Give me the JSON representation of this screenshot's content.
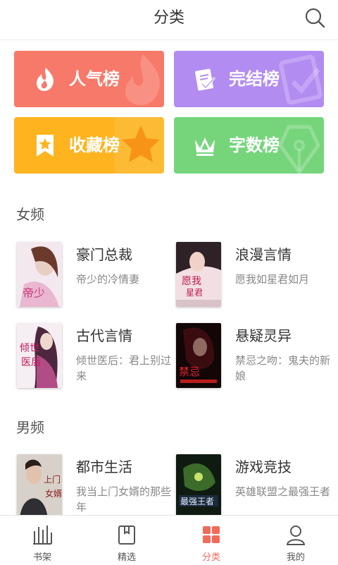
{
  "header": {
    "title": "分类",
    "search_icon": "search-icon"
  },
  "rankings": [
    {
      "label": "人气榜",
      "icon": "flame-icon",
      "color": "#f7796a"
    },
    {
      "label": "完结榜",
      "icon": "check-doc-icon",
      "color": "#b38cf1"
    },
    {
      "label": "收藏榜",
      "icon": "bookmark-star-icon",
      "color": "#fdb41f"
    },
    {
      "label": "字数榜",
      "icon": "crown-icon",
      "color": "#76d57b"
    }
  ],
  "sections": [
    {
      "title": "女频",
      "categories": [
        {
          "name": "豪门总裁",
          "book": "帝少的冷情妻"
        },
        {
          "name": "浪漫言情",
          "book": "愿我如星君如月"
        },
        {
          "name": "古代言情",
          "book": "倾世医后：君上别过来"
        },
        {
          "name": "悬疑灵异",
          "book": "禁忌之吻：鬼夫的新娘"
        }
      ]
    },
    {
      "title": "男频",
      "categories": [
        {
          "name": "都市生活",
          "book": "我当上门女婿的那些年"
        },
        {
          "name": "游戏竞技",
          "book": "英雄联盟之最强王者"
        }
      ]
    }
  ],
  "tabbar": {
    "active": "分类",
    "accent": "#f26a5a",
    "tabs": [
      {
        "label": "书架",
        "icon": "bookshelf-icon"
      },
      {
        "label": "精选",
        "icon": "book-icon"
      },
      {
        "label": "分类",
        "icon": "grid-icon"
      },
      {
        "label": "我的",
        "icon": "user-icon"
      }
    ]
  }
}
